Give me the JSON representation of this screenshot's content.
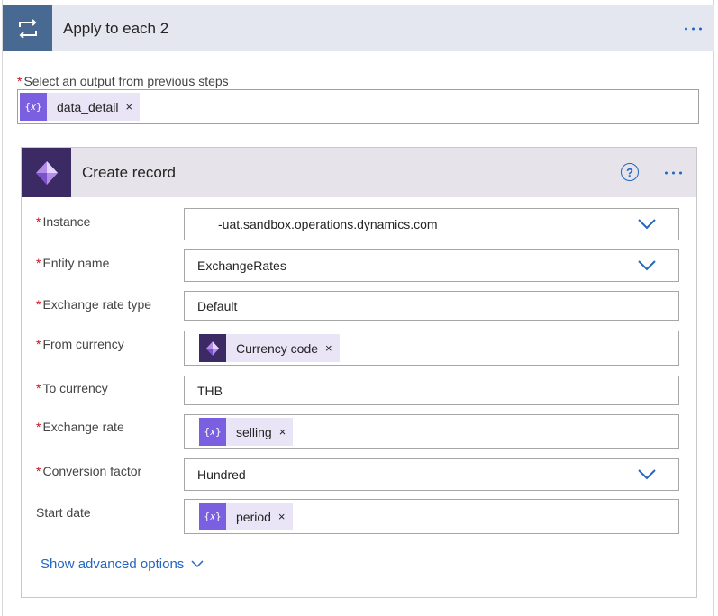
{
  "loop": {
    "title": "Apply to each 2",
    "select_label": "Select an output from previous steps",
    "token": {
      "icon": "{𝑥}",
      "label": "data_detail",
      "close": "×"
    }
  },
  "action": {
    "title": "Create record",
    "help": "?"
  },
  "fields": {
    "instance": {
      "label": "Instance",
      "value": "-uat.sandbox.operations.dynamics.com"
    },
    "entity": {
      "label": "Entity name",
      "value": "ExchangeRates"
    },
    "rate_type": {
      "label": "Exchange rate type",
      "value": "Default"
    },
    "from_currency": {
      "label": "From currency",
      "token": {
        "label": "Currency code",
        "close": "×"
      }
    },
    "to_currency": {
      "label": "To currency",
      "value": "THB"
    },
    "exchange_rate": {
      "label": "Exchange rate",
      "token": {
        "icon": "{𝑥}",
        "label": "selling",
        "close": "×"
      }
    },
    "conversion": {
      "label": "Conversion factor",
      "value": "Hundred"
    },
    "start_date": {
      "label": "Start date",
      "token": {
        "icon": "{𝑥}",
        "label": "period",
        "close": "×"
      }
    }
  },
  "required_mark": "*",
  "advanced_label": "Show advanced options",
  "colors": {
    "accent": "#2266c0",
    "loop_header": "#486991",
    "dynamics": "#3b2a63",
    "variable_token": "#7a5fe0",
    "required": "#c50f1f"
  },
  "icons": {
    "loop": "loop-arrows-icon",
    "action": "dynamics-365-icon",
    "more": "more-dots-icon",
    "help": "help-circle-icon",
    "chevron": "chevron-down-icon"
  }
}
